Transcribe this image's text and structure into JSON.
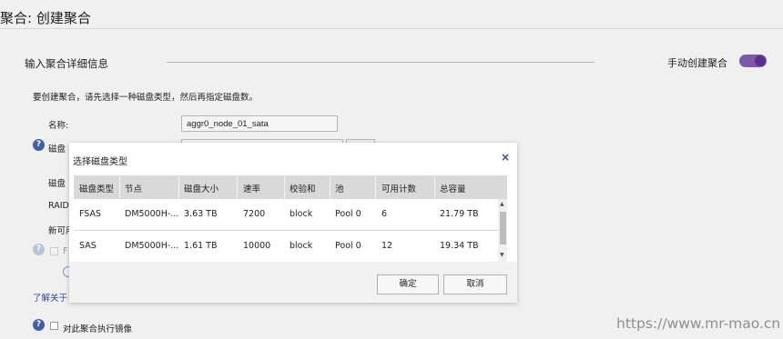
{
  "header": {
    "title": "聚合: 创建聚合"
  },
  "section": {
    "title": "输入聚合详细信息",
    "manual_label": "手动创建聚合",
    "manual_enabled": true
  },
  "form": {
    "intro": "要创建聚合，请先选择一种磁盘类型，然后再指定磁盘数。",
    "name_label": "名称:",
    "name_value": "aggr0_node_01_sata",
    "disk_type_label": "磁盘",
    "disk_label": "磁盘",
    "raid_label": "RAID",
    "new_avail_label": "新可用",
    "f_label": "F",
    "learn_more": "了解关于",
    "mirror_label": "对此聚合执行镜像"
  },
  "dialog": {
    "title": "选择磁盘类型",
    "close_icon": "×",
    "columns": [
      "磁盘类型",
      "节点",
      "磁盘大小",
      "速率",
      "校验和",
      "池",
      "可用计数",
      "总容量"
    ],
    "rows": [
      [
        "FSAS",
        "DM5000H-...",
        "3.63 TB",
        "7200",
        "block",
        "Pool 0",
        "6",
        "21.79 TB"
      ],
      [
        "SAS",
        "DM5000H-...",
        "1.61 TB",
        "10000",
        "block",
        "Pool 0",
        "12",
        "19.34 TB"
      ]
    ],
    "ok_label": "确定",
    "cancel_label": "取消"
  },
  "watermark": "https://www.mr-mao.cn",
  "colors": {
    "accent": "#7d57a8",
    "help": "#3f5fa6",
    "link": "#2a4e96"
  }
}
